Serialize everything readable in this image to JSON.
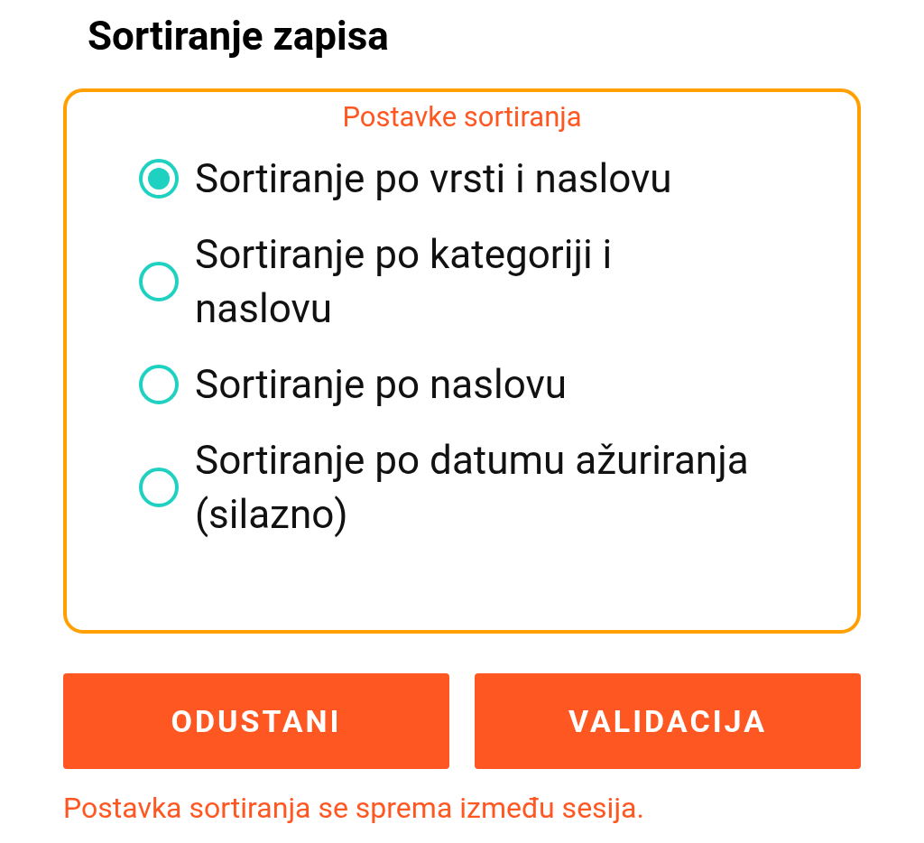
{
  "title": "Sortiranje zapisa",
  "group": {
    "label": "Postavke sortiranja",
    "options": [
      {
        "label": "Sortiranje po vrsti i naslovu",
        "selected": true
      },
      {
        "label": "Sortiranje po kategoriji i naslovu",
        "selected": false
      },
      {
        "label": "Sortiranje po naslovu",
        "selected": false
      },
      {
        "label": "Sortiranje po datumu ažuriranja (silazno)",
        "selected": false
      }
    ]
  },
  "buttons": [
    "ODUSTANI",
    "VALIDACIJA"
  ],
  "note": "Postavka sortiranja se sprema između sesija."
}
